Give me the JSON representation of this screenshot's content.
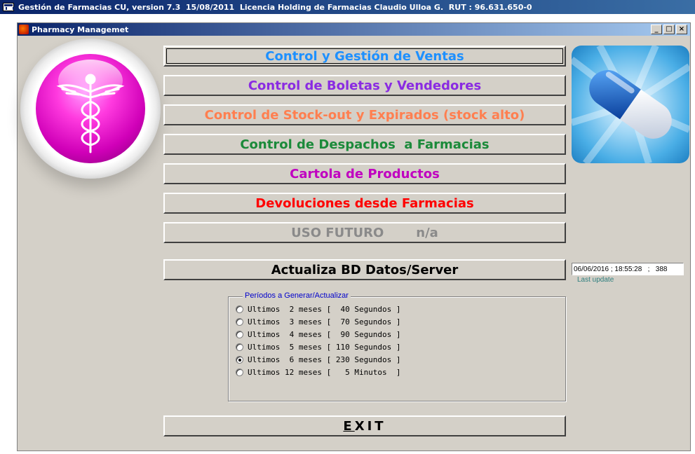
{
  "outer_window": {
    "title": "Gestión de Farmacias CU, version 7.3  15/08/2011  Licencia Holding de Farmacias Claudio Ulloa G.  RUT : 96.631.650-0"
  },
  "child_window": {
    "title": "Pharmacy Managemet",
    "controls": {
      "minimize": "_",
      "maximize": "□",
      "close": "×"
    }
  },
  "menu_buttons": [
    {
      "label": "Control y Gestión de Ventas",
      "color": "#1e90ff"
    },
    {
      "label": "Control de Boletas y Vendedores",
      "color": "#8a2be2"
    },
    {
      "label": "Control de Stock-out y Expirados (stock alto)",
      "color": "#ff7f50"
    },
    {
      "label": "Control de Despachos  a Farmacias",
      "color": "#1b8a3a"
    },
    {
      "label": "Cartola de Productos",
      "color": "#c000c0"
    },
    {
      "label": "Devoluciones desde Farmacias",
      "color": "#ff0000"
    },
    {
      "label": "USO FUTURO",
      "suffix": "n/a",
      "color": "#8a8a8a"
    }
  ],
  "update_button": {
    "label": "Actualiza BD Datos/Server"
  },
  "status": {
    "datetime": "06/06/2016 ; 18:55:28   ;   388",
    "last_update_label": "Last update"
  },
  "periods": {
    "legend": "Períodos a  Generar/Actualizar",
    "options": [
      {
        "label": "Ultimos  2 meses [  40 Segundos ]",
        "checked": false
      },
      {
        "label": "Ultimos  3 meses [  70 Segundos ]",
        "checked": false
      },
      {
        "label": "Ultimos  4 meses [  90 Segundos ]",
        "checked": false
      },
      {
        "label": "Ultimos  5 meses [ 110 Segundos ]",
        "checked": false
      },
      {
        "label": "Ultimos  6 meses [ 230 Segundos ]",
        "checked": true
      },
      {
        "label": "Ultimos 12 meses [   5 Minutos  ]",
        "checked": false
      }
    ]
  },
  "exit_button": {
    "first": "E",
    "rest": "XIT"
  },
  "icons": {
    "app": "app-window-icon",
    "child": "pharmacy-app-icon",
    "logo": "caduceus-icon",
    "pill": "pill-capsule-icon"
  }
}
